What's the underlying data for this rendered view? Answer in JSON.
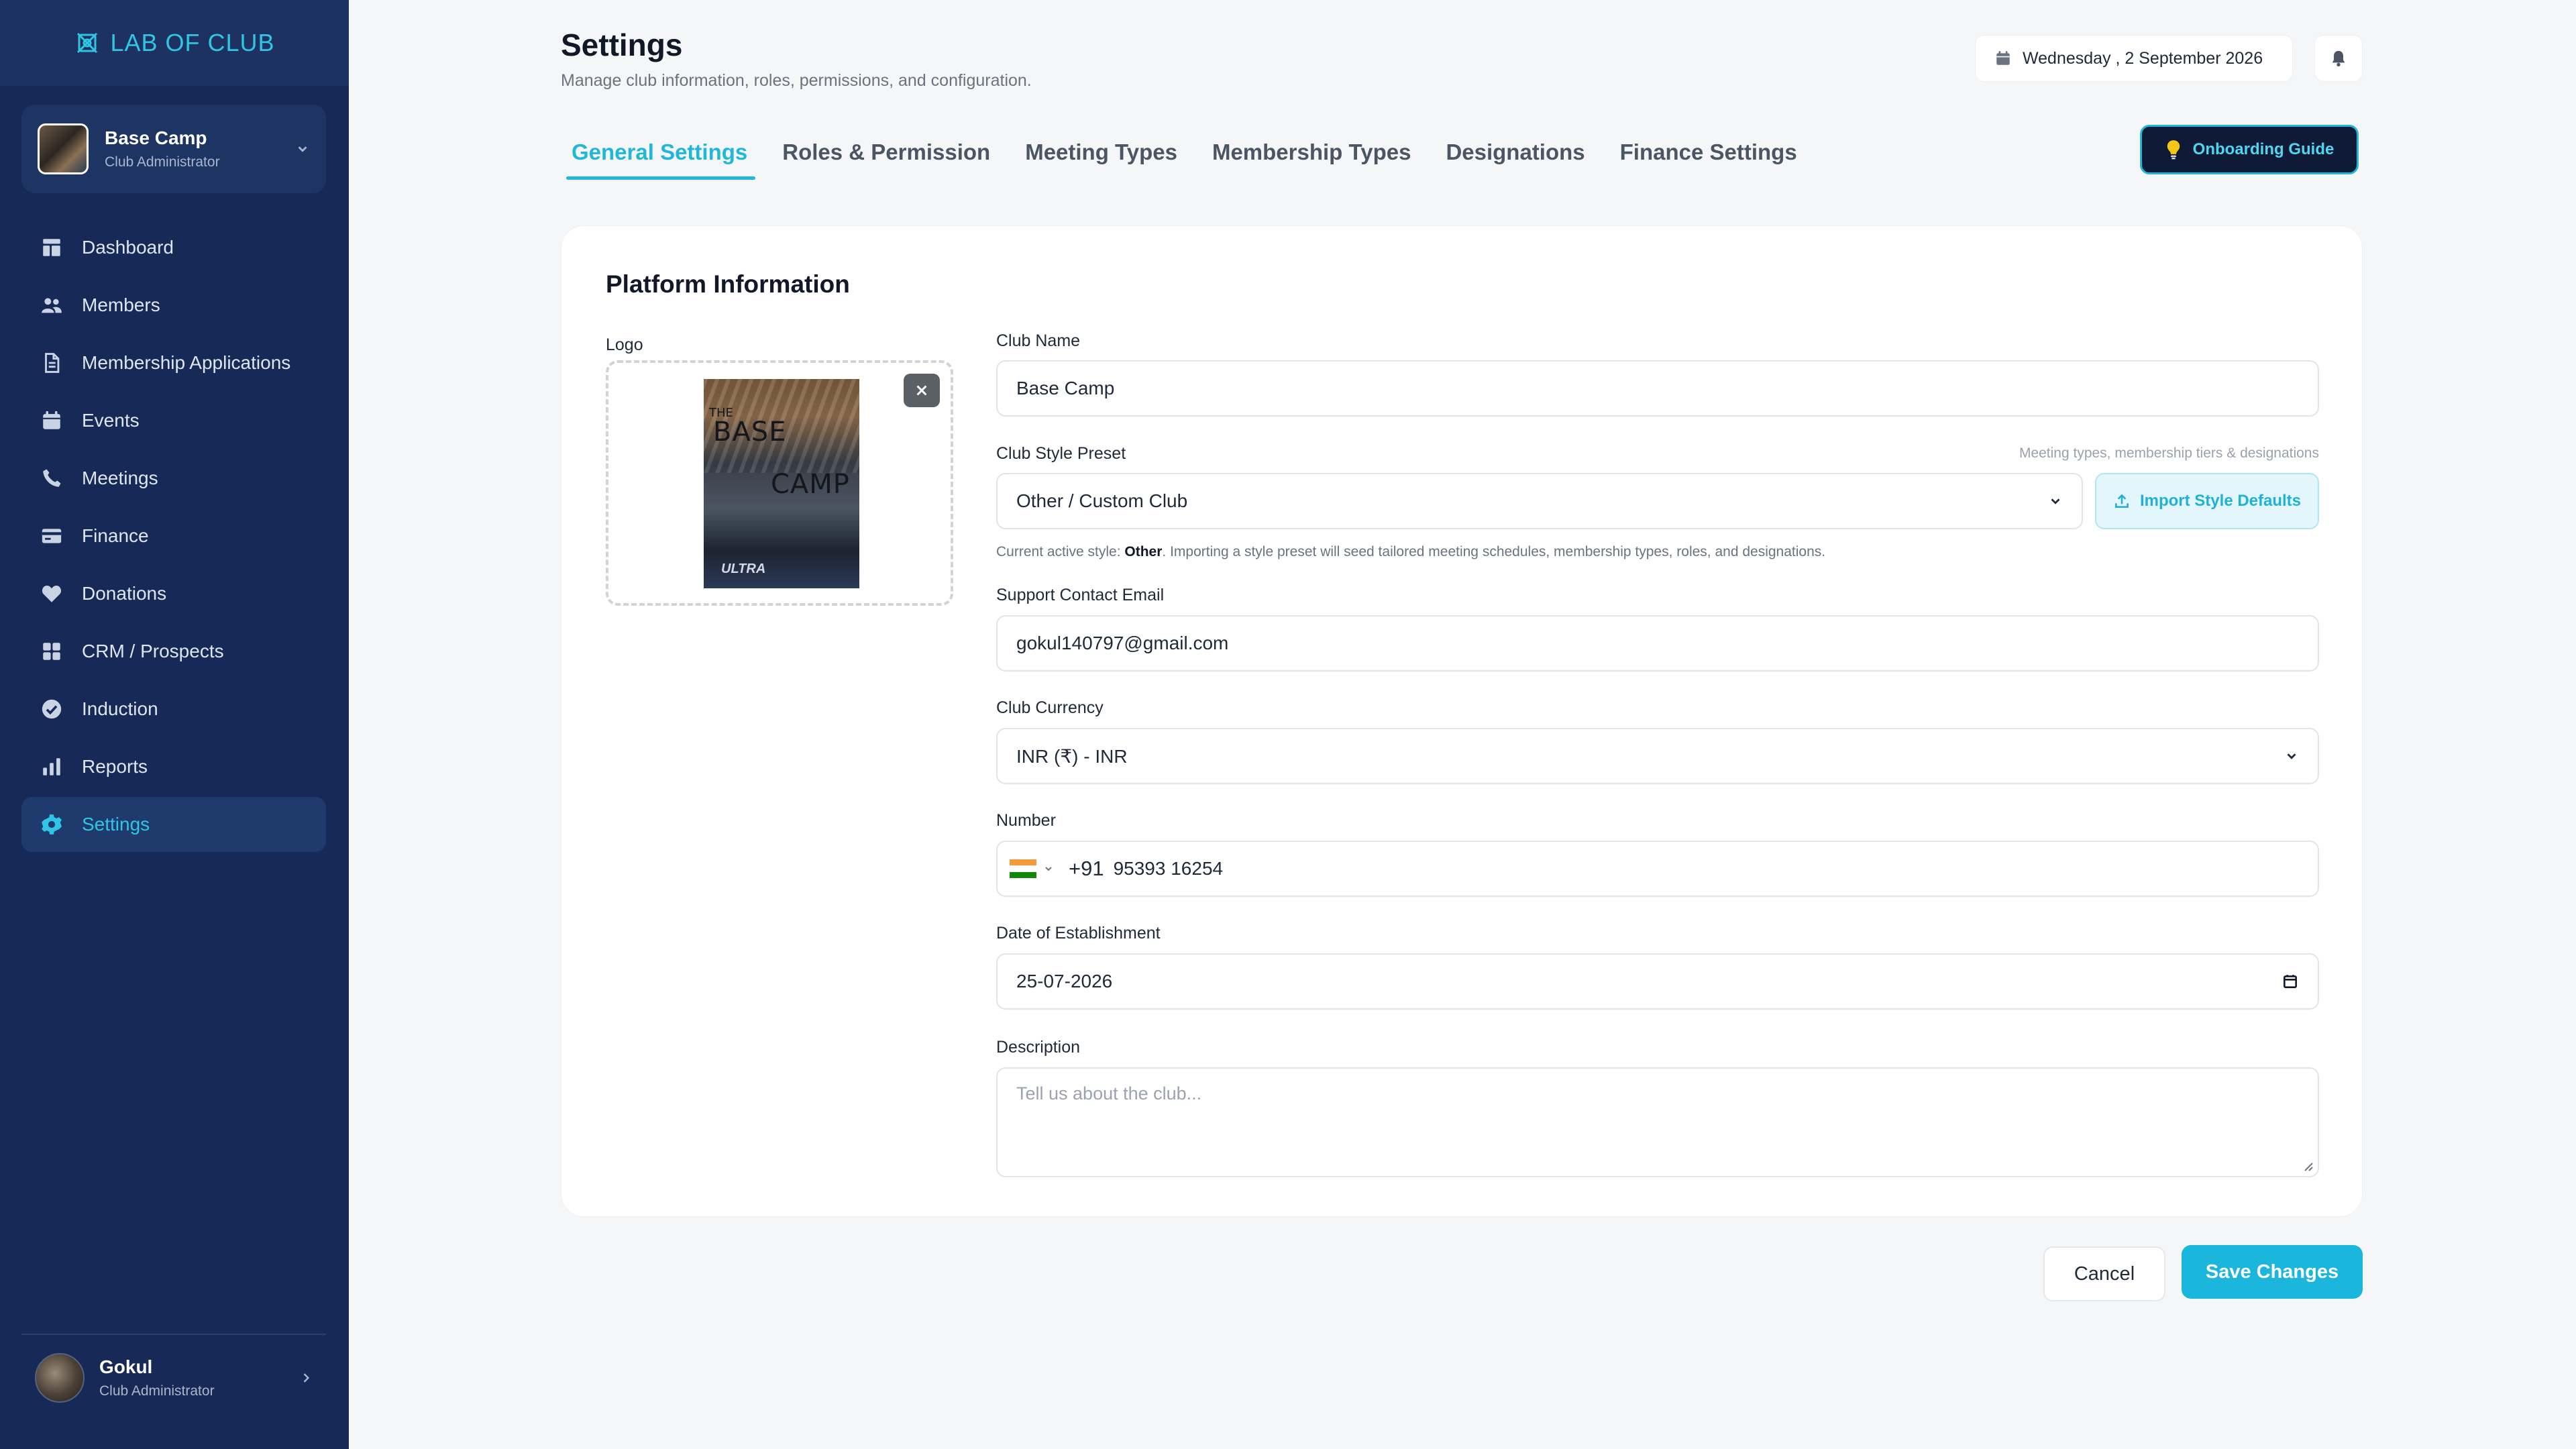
{
  "brand": {
    "name": "LAB OF CLUB",
    "accent": "#2fc6e6"
  },
  "club": {
    "name": "Base Camp",
    "role": "Club Administrator"
  },
  "sidebar": {
    "items": [
      {
        "label": "Dashboard",
        "icon": "dashboard-icon",
        "active": false
      },
      {
        "label": "Members",
        "icon": "members-icon",
        "active": false
      },
      {
        "label": "Membership Applications",
        "icon": "document-icon",
        "active": false
      },
      {
        "label": "Events",
        "icon": "calendar-icon",
        "active": false
      },
      {
        "label": "Meetings",
        "icon": "phone-icon",
        "active": false
      },
      {
        "label": "Finance",
        "icon": "credit-card-icon",
        "active": false
      },
      {
        "label": "Donations",
        "icon": "heart-icon",
        "active": false
      },
      {
        "label": "CRM / Prospects",
        "icon": "grid-icon",
        "active": false
      },
      {
        "label": "Induction",
        "icon": "check-circle-icon",
        "active": false
      },
      {
        "label": "Reports",
        "icon": "bar-chart-icon",
        "active": false
      },
      {
        "label": "Settings",
        "icon": "gear-icon",
        "active": true
      }
    ]
  },
  "user": {
    "name": "Gokul",
    "role": "Club Administrator"
  },
  "header": {
    "title": "Settings",
    "subtitle": "Manage club information, roles, permissions, and configuration.",
    "date": "Wednesday , 2 September 2026"
  },
  "tabs": [
    {
      "label": "General Settings",
      "active": true
    },
    {
      "label": "Roles & Permission",
      "active": false
    },
    {
      "label": "Meeting Types",
      "active": false
    },
    {
      "label": "Membership Types",
      "active": false
    },
    {
      "label": "Designations",
      "active": false
    },
    {
      "label": "Finance Settings",
      "active": false
    }
  ],
  "onboarding": {
    "label": "Onboarding Guide"
  },
  "platform": {
    "title": "Platform Information",
    "logo_label": "Logo",
    "logo_image_text": {
      "top": "THE",
      "line1": "BASE",
      "line2": "CAMP",
      "bottom": "ULTRA"
    },
    "club_name": {
      "label": "Club Name",
      "value": "Base Camp"
    },
    "style_preset": {
      "label": "Club Style Preset",
      "hint": "Meeting types, membership tiers & designations",
      "value": "Other / Custom Club",
      "import_label": "Import Style Defaults",
      "note_prefix": "Current active style: ",
      "note_style": "Other",
      "note_suffix": ". Importing a style preset will seed tailored meeting schedules, membership types, roles, and designations."
    },
    "email": {
      "label": "Support Contact Email",
      "value": "gokul140797@gmail.com"
    },
    "currency": {
      "label": "Club Currency",
      "value": "INR (₹) - INR"
    },
    "phone": {
      "label": "Number",
      "dial": "+91",
      "value": "95393 16254"
    },
    "established": {
      "label": "Date of Establishment",
      "value": "25-07-2026"
    },
    "description": {
      "label": "Description",
      "placeholder": "Tell us about the club..."
    }
  },
  "actions": {
    "cancel": "Cancel",
    "save": "Save Changes"
  },
  "colors": {
    "sidebar_bg": "#172a57",
    "accent": "#21b7d9",
    "save_bg": "#1ab6dc"
  }
}
